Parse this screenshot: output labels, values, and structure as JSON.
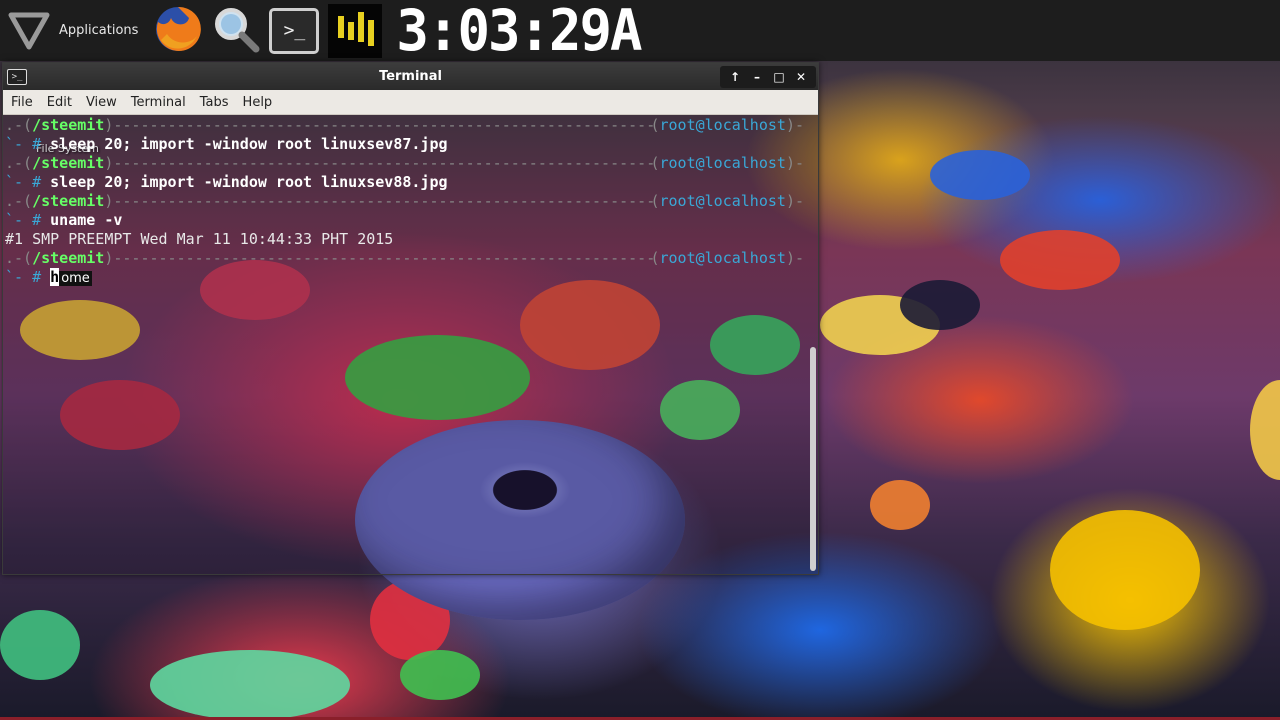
{
  "panel": {
    "applications_label": "Applications",
    "clock": "3:03:29A",
    "launchers": [
      {
        "icon": "firefox-icon"
      },
      {
        "icon": "search-icon"
      },
      {
        "icon": "terminal-icon",
        "glyph": ">_"
      }
    ]
  },
  "desktop": {
    "icon_label": "File System"
  },
  "terminal": {
    "title": "Terminal",
    "window_icon_glyph": ">_",
    "controls": {
      "up": "↑",
      "minimize": "–",
      "maximize": "□",
      "close": "✕"
    },
    "menu": [
      "File",
      "Edit",
      "View",
      "Terminal",
      "Tabs",
      "Help"
    ],
    "prompt": {
      "left_open": ".-(",
      "dir": "/steemit",
      "left_close": ")",
      "right_open": "(",
      "user": "root",
      "at": "@",
      "host": "localhost",
      "right_close": ")-",
      "cmd_prefix": "`- # "
    },
    "lines": [
      {
        "type": "prompt"
      },
      {
        "type": "cmd",
        "text": "sleep 20; import -window root linuxsev87.jpg"
      },
      {
        "type": "prompt"
      },
      {
        "type": "cmd",
        "text": "sleep 20; import -window root linuxsev88.jpg"
      },
      {
        "type": "prompt"
      },
      {
        "type": "cmd",
        "text": "uname -v"
      },
      {
        "type": "output",
        "text": "#1 SMP PREEMPT Wed Mar 11 10:44:33 PHT 2015"
      },
      {
        "type": "prompt"
      },
      {
        "type": "input",
        "cursor_char": "h",
        "suggestion": "ome"
      }
    ]
  }
}
